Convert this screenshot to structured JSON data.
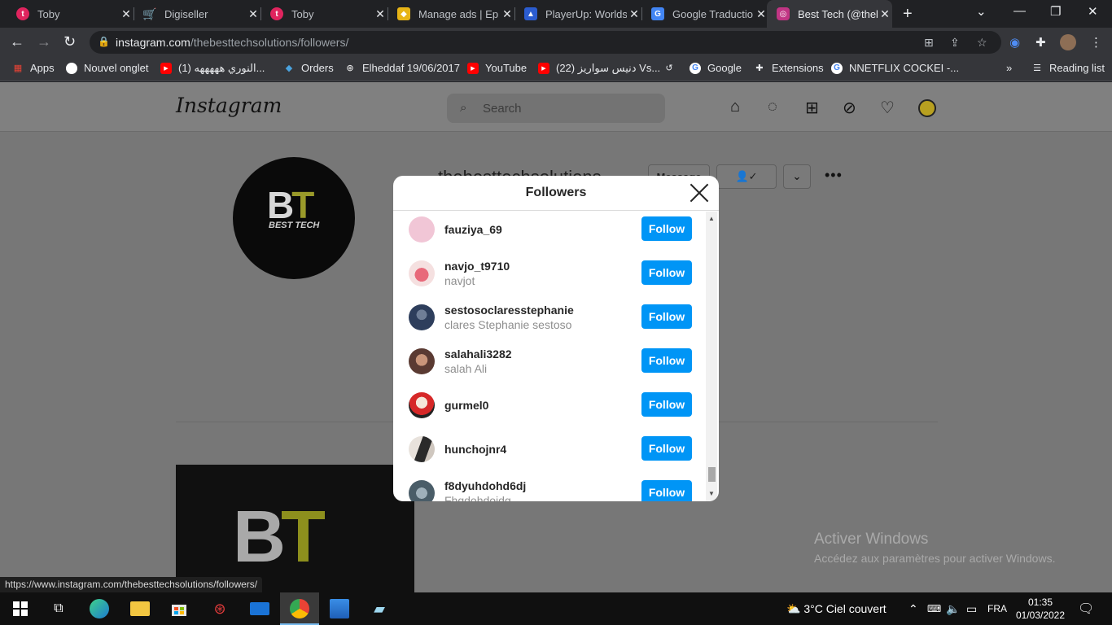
{
  "browser": {
    "tabs": [
      {
        "title": "Toby",
        "icon": "toby-icon",
        "color": "#e0245e"
      },
      {
        "title": "Digiseller",
        "icon": "cart-icon",
        "color": "#4aa3df"
      },
      {
        "title": "Toby",
        "icon": "toby-icon",
        "color": "#e0245e"
      },
      {
        "title": "Manage ads | Ep",
        "icon": "ads-shield-icon",
        "color": "#e7b416"
      },
      {
        "title": "PlayerUp: Worlds",
        "icon": "playerup-icon",
        "color": "#2b5ccf"
      },
      {
        "title": "Google Traductio",
        "icon": "google-translate-icon",
        "color": "#4285f4"
      },
      {
        "title": "Best Tech (@theb",
        "icon": "instagram-icon",
        "color": "#c13584"
      }
    ],
    "url_domain": "instagram.com",
    "url_path": "/thebesttechsolutions/followers/",
    "bookmarks": [
      {
        "label": "Apps",
        "icon": "apps-grid-icon"
      },
      {
        "label": "Nouvel onglet",
        "icon": "globe-icon"
      },
      {
        "label": "(1) النوري هههههه...",
        "icon": "youtube-icon"
      },
      {
        "label": "Orders",
        "icon": "orders-icon"
      },
      {
        "label": "Elheddaf 19/06/2017",
        "icon": "elheddaf-icon"
      },
      {
        "label": "YouTube",
        "icon": "youtube-icon"
      },
      {
        "label": "(22) دنيس سواريز Vs...",
        "icon": "youtube-icon"
      },
      {
        "label": "",
        "icon": "history-icon"
      },
      {
        "label": "Google",
        "icon": "google-icon"
      },
      {
        "label": "Extensions",
        "icon": "puzzle-icon"
      },
      {
        "label": "NNETFLIX COCKEI -...",
        "icon": "google-icon"
      }
    ],
    "overflow": "»",
    "reading_list": "Reading list",
    "status_url": "https://www.instagram.com/thebesttechsolutions/followers/"
  },
  "instagram": {
    "logo": "Instagram",
    "search_placeholder": "Search",
    "handle": "thebesttechsolutions",
    "message_button": "Message",
    "logo_letters": {
      "b": "B",
      "t": "T"
    },
    "logo_sub": "BEST TECH"
  },
  "modal": {
    "title": "Followers",
    "follow_label": "Follow",
    "followers": [
      {
        "username": "fauziya_69",
        "full_name": "",
        "avatar_color": "#f1c6d6"
      },
      {
        "username": "navjo_t9710",
        "full_name": "navjot",
        "avatar_color": "#f3b8b8"
      },
      {
        "username": "sestosoclaresstephanie",
        "full_name": "clares Stephanie sestoso",
        "avatar_color": "#2e3e5c"
      },
      {
        "username": "salahali3282",
        "full_name": "salah Ali",
        "avatar_color": "#8c5a48"
      },
      {
        "username": "gurmel0",
        "full_name": "",
        "avatar_color": "#d62828"
      },
      {
        "username": "hunchojnr4",
        "full_name": "",
        "avatar_color": "#3b3b3b"
      },
      {
        "username": "f8dyuhdohd6dj",
        "full_name": "Fhgdohdoidg",
        "avatar_color": "#5d7380"
      }
    ]
  },
  "watermark": {
    "title": "Activer Windows",
    "subtitle": "Accédez aux paramètres pour activer Windows."
  },
  "taskbar": {
    "weather": "3°C  Ciel couvert",
    "language": "FRA",
    "time": "01:35",
    "date": "01/03/2022"
  }
}
